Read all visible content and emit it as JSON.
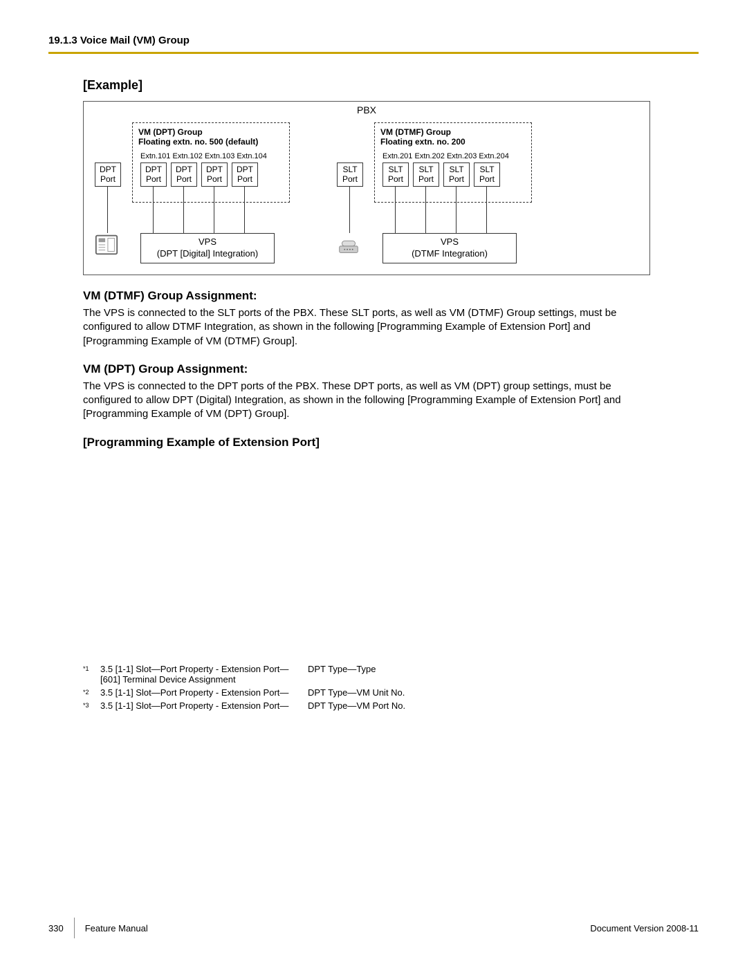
{
  "header": {
    "section_number": "19.1.3",
    "section_title": "Voice Mail (VM) Group"
  },
  "headings": {
    "example": "[Example]",
    "dtmf_assign": "VM (DTMF) Group Assignment:",
    "dpt_assign": "VM (DPT) Group Assignment:",
    "prog_example": "[Programming Example of Extension Port]"
  },
  "paragraphs": {
    "dtmf": "The VPS is connected to the SLT ports of the PBX. These SLT ports, as well as VM (DTMF) Group settings, must be configured to allow DTMF Integration, as shown in the following [Programming Example of Extension Port] and [Programming Example of VM (DTMF) Group].",
    "dpt": "The VPS is connected to the DPT ports of the PBX. These DPT ports, as well as VM (DPT) group settings, must be configured to allow DPT (Digital) Integration, as shown in the following [Programming Example of Extension Port] and [Programming Example of VM (DPT) Group]."
  },
  "diagram": {
    "pbx": "PBX",
    "dpt_group_title": "VM (DPT) Group",
    "dpt_group_sub": "Floating extn. no. 500 (default)",
    "dpt_extns": "Extn.101 Extn.102 Extn.103 Extn.104",
    "dtmf_group_title": "VM (DTMF) Group",
    "dtmf_group_sub": "Floating extn. no. 200",
    "dtmf_extns": "Extn.201 Extn.202 Extn.203 Extn.204",
    "port_dpt": "DPT",
    "port_slt": "SLT",
    "port_label": "Port",
    "vps": "VPS",
    "vps_dpt_sub": "(DPT [Digital] Integration)",
    "vps_dtmf_sub": "(DTMF Integration)"
  },
  "footnotes": [
    {
      "sup": "*1",
      "left_line1": "3.5  [1-1] Slot—Port Property - Extension Port—",
      "left_line2": "[601] Terminal Device Assignment",
      "right": "DPT Type—Type"
    },
    {
      "sup": "*2",
      "left_line1": "3.5  [1-1] Slot—Port Property - Extension Port—",
      "left_line2": "",
      "right": "DPT Type—VM Unit No."
    },
    {
      "sup": "*3",
      "left_line1": "3.5  [1-1] Slot—Port Property - Extension Port—",
      "left_line2": "",
      "right": "DPT Type—VM Port No."
    }
  ],
  "footer": {
    "page_number": "330",
    "doc_title": "Feature Manual",
    "doc_version": "Document Version  2008-11"
  }
}
